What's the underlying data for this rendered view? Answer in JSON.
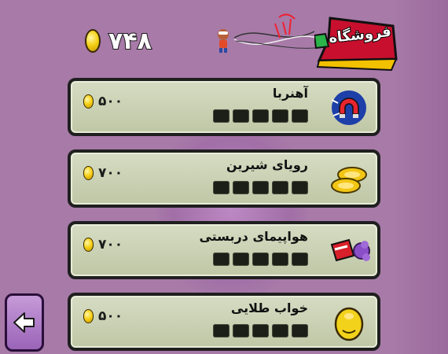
{
  "header": {
    "coin_balance": "۷۴۸",
    "shop_title": "فروشگاه"
  },
  "items": [
    {
      "name": "آهنربا",
      "price": "۵۰۰",
      "level": 0,
      "level_max": 5,
      "icon": "magnet-icon"
    },
    {
      "name": "رویای شیرین",
      "price": "۷۰۰",
      "level": 0,
      "level_max": 5,
      "icon": "gold-coins-icon"
    },
    {
      "name": "هواپیمای دربستی",
      "price": "۷۰۰",
      "level": 0,
      "level_max": 5,
      "icon": "plane-icon"
    },
    {
      "name": "خواب طلایی",
      "price": "۵۰۰",
      "level": 0,
      "level_max": 5,
      "icon": "golden-pig-icon"
    }
  ],
  "colors": {
    "background": "#a77aa8",
    "card": "#c9cfb3",
    "coin": "#f7d21a",
    "back_button": "#b07fcb"
  }
}
